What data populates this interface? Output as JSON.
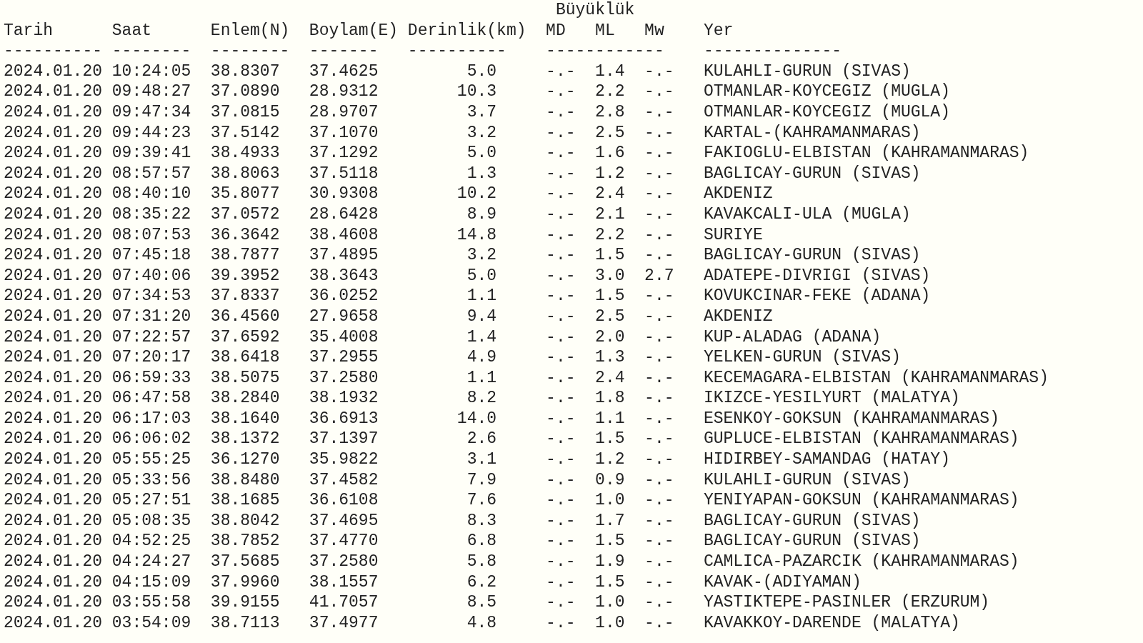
{
  "group_header": "Büyüklük",
  "columns": [
    "Tarih",
    "Saat",
    "Enlem(N)",
    "Boylam(E)",
    "Derinlik(km)",
    "MD",
    "ML",
    "Mw",
    "Yer"
  ],
  "separators": [
    "----------",
    "--------",
    "--------",
    "-------",
    "----------",
    "------------",
    "--------------"
  ],
  "rows": [
    {
      "date": "2024.01.20",
      "time": "10:24:05",
      "lat": "38.8307",
      "lon": "37.4625",
      "depth": "5.0",
      "md": "-.-",
      "ml": "1.4",
      "mw": "-.-",
      "place": "KULAHLI-GURUN (SIVAS)"
    },
    {
      "date": "2024.01.20",
      "time": "09:48:27",
      "lat": "37.0890",
      "lon": "28.9312",
      "depth": "10.3",
      "md": "-.-",
      "ml": "2.2",
      "mw": "-.-",
      "place": "OTMANLAR-KOYCEGIZ (MUGLA)"
    },
    {
      "date": "2024.01.20",
      "time": "09:47:34",
      "lat": "37.0815",
      "lon": "28.9707",
      "depth": "3.7",
      "md": "-.-",
      "ml": "2.8",
      "mw": "-.-",
      "place": "OTMANLAR-KOYCEGIZ (MUGLA)"
    },
    {
      "date": "2024.01.20",
      "time": "09:44:23",
      "lat": "37.5142",
      "lon": "37.1070",
      "depth": "3.2",
      "md": "-.-",
      "ml": "2.5",
      "mw": "-.-",
      "place": "KARTAL-(KAHRAMANMARAS)"
    },
    {
      "date": "2024.01.20",
      "time": "09:39:41",
      "lat": "38.4933",
      "lon": "37.1292",
      "depth": "5.0",
      "md": "-.-",
      "ml": "1.6",
      "mw": "-.-",
      "place": "FAKIOGLU-ELBISTAN (KAHRAMANMARAS)"
    },
    {
      "date": "2024.01.20",
      "time": "08:57:57",
      "lat": "38.8063",
      "lon": "37.5118",
      "depth": "1.3",
      "md": "-.-",
      "ml": "1.2",
      "mw": "-.-",
      "place": "BAGLICAY-GURUN (SIVAS)"
    },
    {
      "date": "2024.01.20",
      "time": "08:40:10",
      "lat": "35.8077",
      "lon": "30.9308",
      "depth": "10.2",
      "md": "-.-",
      "ml": "2.4",
      "mw": "-.-",
      "place": "AKDENIZ"
    },
    {
      "date": "2024.01.20",
      "time": "08:35:22",
      "lat": "37.0572",
      "lon": "28.6428",
      "depth": "8.9",
      "md": "-.-",
      "ml": "2.1",
      "mw": "-.-",
      "place": "KAVAKCALI-ULA (MUGLA)"
    },
    {
      "date": "2024.01.20",
      "time": "08:07:53",
      "lat": "36.3642",
      "lon": "38.4608",
      "depth": "14.8",
      "md": "-.-",
      "ml": "2.2",
      "mw": "-.-",
      "place": "SURIYE"
    },
    {
      "date": "2024.01.20",
      "time": "07:45:18",
      "lat": "38.7877",
      "lon": "37.4895",
      "depth": "3.2",
      "md": "-.-",
      "ml": "1.5",
      "mw": "-.-",
      "place": "BAGLICAY-GURUN (SIVAS)"
    },
    {
      "date": "2024.01.20",
      "time": "07:40:06",
      "lat": "39.3952",
      "lon": "38.3643",
      "depth": "5.0",
      "md": "-.-",
      "ml": "3.0",
      "mw": "2.7",
      "place": "ADATEPE-DIVRIGI (SIVAS)"
    },
    {
      "date": "2024.01.20",
      "time": "07:34:53",
      "lat": "37.8337",
      "lon": "36.0252",
      "depth": "1.1",
      "md": "-.-",
      "ml": "1.5",
      "mw": "-.-",
      "place": "KOVUKCINAR-FEKE (ADANA)"
    },
    {
      "date": "2024.01.20",
      "time": "07:31:20",
      "lat": "36.4560",
      "lon": "27.9658",
      "depth": "9.4",
      "md": "-.-",
      "ml": "2.5",
      "mw": "-.-",
      "place": "AKDENIZ"
    },
    {
      "date": "2024.01.20",
      "time": "07:22:57",
      "lat": "37.6592",
      "lon": "35.4008",
      "depth": "1.4",
      "md": "-.-",
      "ml": "2.0",
      "mw": "-.-",
      "place": "KUP-ALADAG (ADANA)"
    },
    {
      "date": "2024.01.20",
      "time": "07:20:17",
      "lat": "38.6418",
      "lon": "37.2955",
      "depth": "4.9",
      "md": "-.-",
      "ml": "1.3",
      "mw": "-.-",
      "place": "YELKEN-GURUN (SIVAS)"
    },
    {
      "date": "2024.01.20",
      "time": "06:59:33",
      "lat": "38.5075",
      "lon": "37.2580",
      "depth": "1.1",
      "md": "-.-",
      "ml": "2.4",
      "mw": "-.-",
      "place": "KECEMAGARA-ELBISTAN (KAHRAMANMARAS)"
    },
    {
      "date": "2024.01.20",
      "time": "06:47:58",
      "lat": "38.2840",
      "lon": "38.1932",
      "depth": "8.2",
      "md": "-.-",
      "ml": "1.8",
      "mw": "-.-",
      "place": "IKIZCE-YESILYURT (MALATYA)"
    },
    {
      "date": "2024.01.20",
      "time": "06:17:03",
      "lat": "38.1640",
      "lon": "36.6913",
      "depth": "14.0",
      "md": "-.-",
      "ml": "1.1",
      "mw": "-.-",
      "place": "ESENKOY-GOKSUN (KAHRAMANMARAS)"
    },
    {
      "date": "2024.01.20",
      "time": "06:06:02",
      "lat": "38.1372",
      "lon": "37.1397",
      "depth": "2.6",
      "md": "-.-",
      "ml": "1.5",
      "mw": "-.-",
      "place": "GUPLUCE-ELBISTAN (KAHRAMANMARAS)"
    },
    {
      "date": "2024.01.20",
      "time": "05:55:25",
      "lat": "36.1270",
      "lon": "35.9822",
      "depth": "3.1",
      "md": "-.-",
      "ml": "1.2",
      "mw": "-.-",
      "place": "HIDIRBEY-SAMANDAG (HATAY)"
    },
    {
      "date": "2024.01.20",
      "time": "05:33:56",
      "lat": "38.8480",
      "lon": "37.4582",
      "depth": "7.9",
      "md": "-.-",
      "ml": "0.9",
      "mw": "-.-",
      "place": "KULAHLI-GURUN (SIVAS)"
    },
    {
      "date": "2024.01.20",
      "time": "05:27:51",
      "lat": "38.1685",
      "lon": "36.6108",
      "depth": "7.6",
      "md": "-.-",
      "ml": "1.0",
      "mw": "-.-",
      "place": "YENIYAPAN-GOKSUN (KAHRAMANMARAS)"
    },
    {
      "date": "2024.01.20",
      "time": "05:08:35",
      "lat": "38.8042",
      "lon": "37.4695",
      "depth": "8.3",
      "md": "-.-",
      "ml": "1.7",
      "mw": "-.-",
      "place": "BAGLICAY-GURUN (SIVAS)"
    },
    {
      "date": "2024.01.20",
      "time": "04:52:25",
      "lat": "38.7852",
      "lon": "37.4770",
      "depth": "6.8",
      "md": "-.-",
      "ml": "1.5",
      "mw": "-.-",
      "place": "BAGLICAY-GURUN (SIVAS)"
    },
    {
      "date": "2024.01.20",
      "time": "04:24:27",
      "lat": "37.5685",
      "lon": "37.2580",
      "depth": "5.8",
      "md": "-.-",
      "ml": "1.9",
      "mw": "-.-",
      "place": "CAMLICA-PAZARCIK (KAHRAMANMARAS)"
    },
    {
      "date": "2024.01.20",
      "time": "04:15:09",
      "lat": "37.9960",
      "lon": "38.1557",
      "depth": "6.2",
      "md": "-.-",
      "ml": "1.5",
      "mw": "-.-",
      "place": "KAVAK-(ADIYAMAN)"
    },
    {
      "date": "2024.01.20",
      "time": "03:55:58",
      "lat": "39.9155",
      "lon": "41.7057",
      "depth": "8.5",
      "md": "-.-",
      "ml": "1.0",
      "mw": "-.-",
      "place": "YASTIKTEPE-PASINLER (ERZURUM)"
    },
    {
      "date": "2024.01.20",
      "time": "03:54:09",
      "lat": "38.7113",
      "lon": "37.4977",
      "depth": "4.8",
      "md": "-.-",
      "ml": "1.0",
      "mw": "-.-",
      "place": "KAVAKKOY-DARENDE (MALATYA)"
    }
  ]
}
